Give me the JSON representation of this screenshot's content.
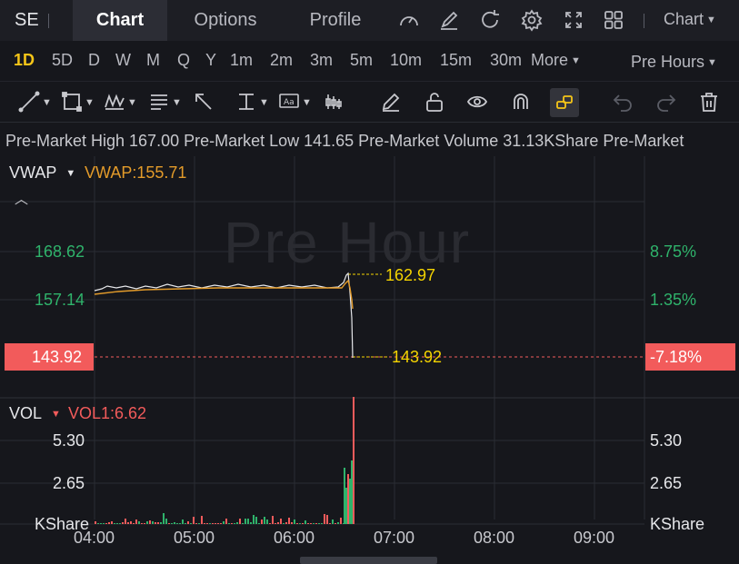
{
  "header": {
    "ticker": "SE",
    "tabs": [
      "Chart",
      "Options",
      "Profile"
    ],
    "chart_type": "Chart",
    "icons": [
      "gauge-icon",
      "edit-icon",
      "refresh-icon",
      "settings-icon",
      "fullscreen-icon",
      "layout-grid-icon"
    ]
  },
  "periods": {
    "items": [
      "1D",
      "5D",
      "D",
      "W",
      "M",
      "Q",
      "Y",
      "1m",
      "2m",
      "3m",
      "5m",
      "10m",
      "15m",
      "30m",
      "More"
    ],
    "active": "1D",
    "session": "Pre Hours"
  },
  "toolbar": {
    "icons": [
      "trend-line-icon",
      "rectangle-icon",
      "pattern-icon",
      "fibonacci-icon",
      "arrow-icon",
      "horizontal-line-icon",
      "text-icon",
      "indicator-icon",
      "pencil-icon",
      "lock-icon",
      "eye-icon",
      "magnet-icon",
      "link-icon",
      "undo-icon",
      "redo-icon",
      "trash-icon"
    ]
  },
  "stats": {
    "text": "Pre-Market High 167.00 Pre-Market Low 141.65 Pre-Market Volume 31.13KShare Pre-Market"
  },
  "price_panel": {
    "indicator": "VWAP",
    "vwap_label": "VWAP:155.71",
    "watermark": "Pre Hour",
    "left_ticks": [
      "168.62",
      "157.14"
    ],
    "right_ticks": [
      "8.75%",
      "1.35%"
    ],
    "current_price": "143.92",
    "current_pct": "-7.18%",
    "marker_high": "162.97",
    "marker_last": "143.92",
    "colors": {
      "up": "#2fb36b",
      "down": "#f25b5b",
      "vwap": "#e39b2a",
      "marker": "#f5d400"
    }
  },
  "volume_panel": {
    "indicator": "VOL",
    "vol_label": "VOL1:6.62",
    "left_ticks": [
      "5.30",
      "2.65",
      "KShare"
    ],
    "right_ticks": [
      "5.30",
      "2.65",
      "KShare"
    ]
  },
  "x_axis": [
    "04:00",
    "05:00",
    "06:00",
    "07:00",
    "08:00",
    "09:00"
  ],
  "chart_data": {
    "type": "line",
    "x_ticks": [
      "04:00",
      "05:00",
      "06:00",
      "07:00",
      "08:00",
      "09:00"
    ],
    "series": [
      {
        "name": "VWAP",
        "values": [
          155.71
        ]
      }
    ],
    "price_ticks": [
      168.62,
      157.14
    ],
    "percent_ticks": [
      "8.75%",
      "1.35%"
    ],
    "last_price": 143.92,
    "last_change_pct": "-7.18%",
    "session_high_marker": 162.97,
    "volume_ticks": [
      5.3,
      2.65
    ],
    "volume_unit": "KShare",
    "vol1": 6.62
  }
}
